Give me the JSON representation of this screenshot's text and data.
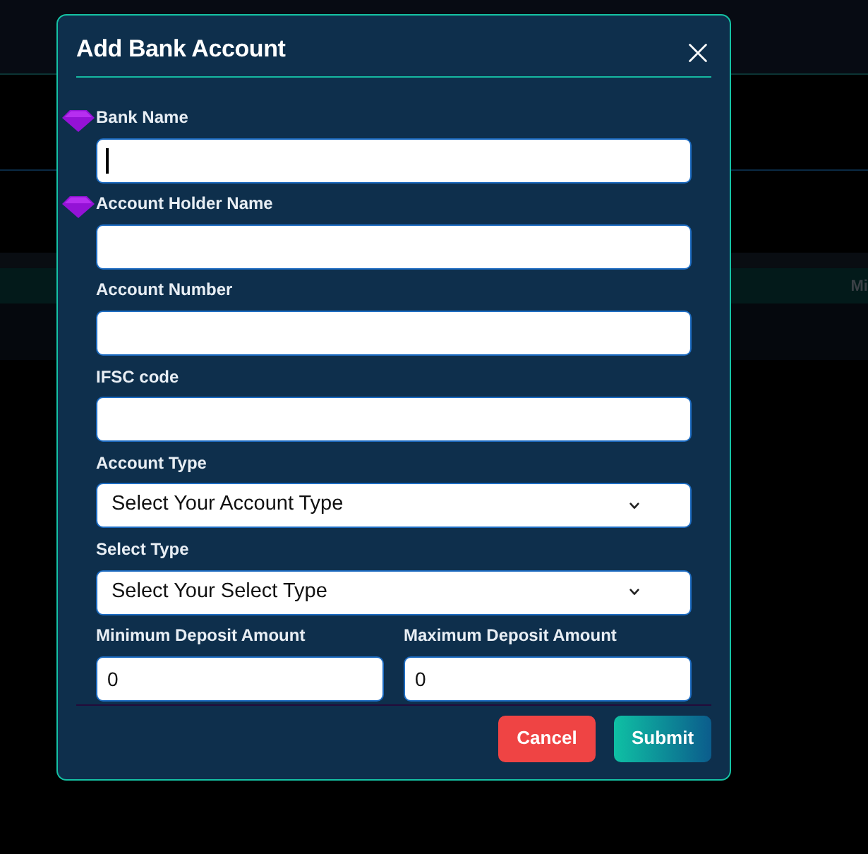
{
  "backdrop": {
    "table_header_text": "Mi"
  },
  "modal": {
    "title": "Add Bank Account"
  },
  "fields": [
    {
      "kind": "text",
      "label": "Bank Name",
      "focused": true,
      "autofill_icon": true
    },
    {
      "kind": "text",
      "label": "Account Holder Name",
      "focused": false,
      "autofill_icon": true
    },
    {
      "kind": "text",
      "label": "Account Number",
      "focused": false,
      "autofill_icon": false
    },
    {
      "kind": "text",
      "label": "IFSC code",
      "focused": false,
      "autofill_icon": false
    },
    {
      "kind": "select",
      "label": "Account Type",
      "value": "Select Your Account Type",
      "focused": false,
      "autofill_icon": false
    },
    {
      "kind": "select",
      "label": "Select Type",
      "value": "Select Your Select Type",
      "focused": false,
      "autofill_icon": false
    }
  ],
  "deposit_amounts": [
    {
      "label": "Minimum Deposit Amount",
      "value": "0"
    },
    {
      "label": "Maximum Deposit Amount",
      "value": "0"
    }
  ],
  "buttons": [
    {
      "kind": "cancel",
      "label": "Cancel"
    },
    {
      "kind": "submit",
      "label": "Submit"
    }
  ]
}
